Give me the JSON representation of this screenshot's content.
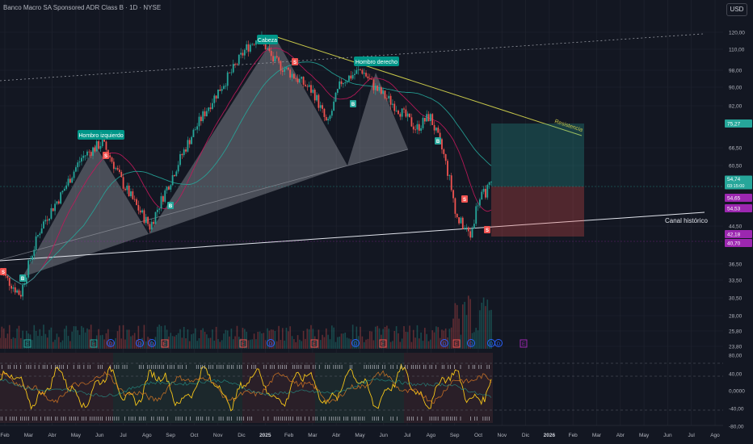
{
  "header": {
    "title": "Banco Macro SA Sponsored ADR Class B · 1D · NYSE",
    "currency": "USD"
  },
  "colors": {
    "bg": "#131722",
    "up": "#26a69a",
    "down": "#ef5350",
    "ma1": "#c2185b",
    "ma2": "#26a69a",
    "resistance": "#c8c84a",
    "channel": "#e0e3eb",
    "grid": "#1e222d",
    "magenta": "#9c27b0",
    "axis": "#b2b5be"
  },
  "chart_data": {
    "type": "candlestick",
    "price_ticks": [
      "120,00",
      "110,00",
      "98,00",
      "90,00",
      "82,00",
      "75,27",
      "66,50",
      "60,50",
      "54,74",
      "54,65",
      "54,53",
      "44,50",
      "42,18",
      "40,70",
      "36,50",
      "33,50",
      "30,50",
      "28,00",
      "25,80",
      "23,80"
    ],
    "osc_ticks": [
      "80,00",
      "40,00",
      "0,0000",
      "-40,00",
      "-80,00"
    ],
    "time_labels": [
      "Feb",
      "Mar",
      "Abr",
      "May",
      "Jun",
      "Jul",
      "Ago",
      "Sep",
      "Oct",
      "Nov",
      "Dic",
      "2025",
      "Feb",
      "Mar",
      "Abr",
      "May",
      "Jun",
      "Jul",
      "Ago",
      "Sep",
      "Oct",
      "Nov",
      "Dic",
      "2026",
      "Feb",
      "Mar",
      "Abr",
      "May",
      "Jun",
      "Jul",
      "Ago"
    ],
    "badges": [
      {
        "price": "75,27",
        "color": "#26a69a"
      },
      {
        "price": "54,74",
        "sub": "03:15:00",
        "color": "#26a69a"
      },
      {
        "price": "54,65",
        "color": "#9c27b0"
      },
      {
        "price": "54,53",
        "color": "#9c27b0"
      },
      {
        "price": "42,18",
        "color": "#9c27b0"
      },
      {
        "price": "40,70",
        "color": "#9c27b0"
      }
    ],
    "annotations": [
      "Hombro izquierdo",
      "Cabeza",
      "Hombro derecho",
      "Resistencia",
      "Canal histórico"
    ],
    "signals": [
      "B",
      "S",
      "E",
      "D"
    ],
    "price_path": [
      [
        0,
        35
      ],
      [
        0.03,
        31
      ],
      [
        0.06,
        44
      ],
      [
        0.09,
        52
      ],
      [
        0.12,
        63
      ],
      [
        0.15,
        68
      ],
      [
        0.18,
        55
      ],
      [
        0.2,
        49
      ],
      [
        0.22,
        44
      ],
      [
        0.25,
        56
      ],
      [
        0.28,
        70
      ],
      [
        0.31,
        84
      ],
      [
        0.34,
        98
      ],
      [
        0.36,
        110
      ],
      [
        0.38,
        118
      ],
      [
        0.4,
        104
      ],
      [
        0.43,
        96
      ],
      [
        0.46,
        88
      ],
      [
        0.48,
        74
      ],
      [
        0.5,
        93
      ],
      [
        0.53,
        99
      ],
      [
        0.55,
        90
      ],
      [
        0.58,
        82
      ],
      [
        0.61,
        73
      ],
      [
        0.63,
        78
      ],
      [
        0.65,
        64
      ],
      [
        0.67,
        46
      ],
      [
        0.69,
        42
      ],
      [
        0.7,
        50
      ],
      [
        0.72,
        54.74
      ]
    ]
  }
}
